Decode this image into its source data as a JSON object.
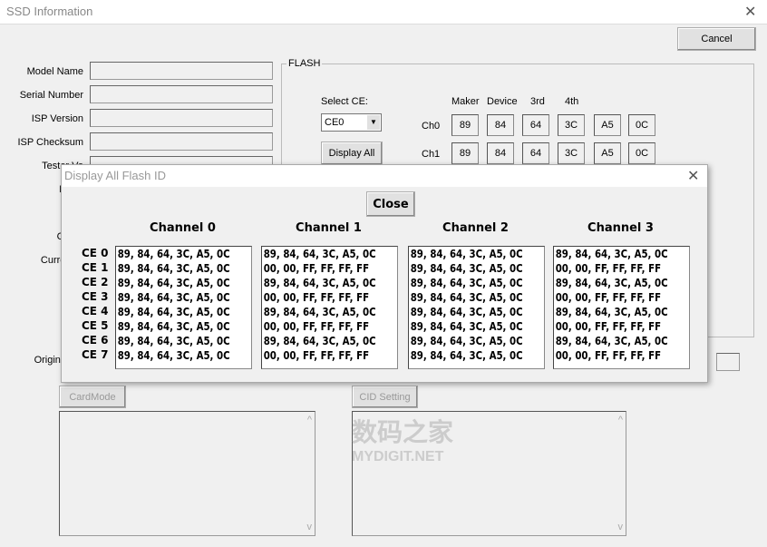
{
  "window": {
    "title": "SSD Information",
    "cancel_label": "Cancel"
  },
  "left_labels": [
    "Model Name",
    "Serial Number",
    "ISP Version",
    "ISP Checksum",
    "Tester Ve",
    "IC Ve",
    "Tota",
    "CID S",
    "Current S",
    "Original Ba"
  ],
  "flash": {
    "group_label": "FLASH",
    "select_ce_label": "Select CE:",
    "select_ce_value": "CE0",
    "display_all_label": "Display All",
    "col_headers": [
      "Maker",
      "Device",
      "3rd",
      "4th"
    ],
    "rows": [
      {
        "label": "Ch0",
        "values": [
          "89",
          "84",
          "64",
          "3C",
          "A5",
          "0C"
        ]
      },
      {
        "label": "Ch1",
        "values": [
          "89",
          "84",
          "64",
          "3C",
          "A5",
          "0C"
        ]
      }
    ]
  },
  "dialog": {
    "title": "Display All Flash ID",
    "close_label": "Close",
    "ce_labels": [
      "CE 0",
      "CE 1",
      "CE 2",
      "CE 3",
      "CE 4",
      "CE 5",
      "CE 6",
      "CE 7"
    ],
    "channels": [
      {
        "name": "Channel 0",
        "lines": [
          "89, 84, 64, 3C, A5, 0C",
          "89, 84, 64, 3C, A5, 0C",
          "89, 84, 64, 3C, A5, 0C",
          "89, 84, 64, 3C, A5, 0C",
          "89, 84, 64, 3C, A5, 0C",
          "89, 84, 64, 3C, A5, 0C",
          "89, 84, 64, 3C, A5, 0C",
          "89, 84, 64, 3C, A5, 0C"
        ]
      },
      {
        "name": "Channel 1",
        "lines": [
          "89, 84, 64, 3C, A5, 0C",
          "00, 00, FF, FF, FF, FF",
          "89, 84, 64, 3C, A5, 0C",
          "00, 00, FF, FF, FF, FF",
          "89, 84, 64, 3C, A5, 0C",
          "00, 00, FF, FF, FF, FF",
          "89, 84, 64, 3C, A5, 0C",
          "00, 00, FF, FF, FF, FF"
        ]
      },
      {
        "name": "Channel 2",
        "lines": [
          "89, 84, 64, 3C, A5, 0C",
          "89, 84, 64, 3C, A5, 0C",
          "89, 84, 64, 3C, A5, 0C",
          "89, 84, 64, 3C, A5, 0C",
          "89, 84, 64, 3C, A5, 0C",
          "89, 84, 64, 3C, A5, 0C",
          "89, 84, 64, 3C, A5, 0C",
          "89, 84, 64, 3C, A5, 0C"
        ]
      },
      {
        "name": "Channel 3",
        "lines": [
          "89, 84, 64, 3C, A5, 0C",
          "00, 00, FF, FF, FF, FF",
          "89, 84, 64, 3C, A5, 0C",
          "00, 00, FF, FF, FF, FF",
          "89, 84, 64, 3C, A5, 0C",
          "00, 00, FF, FF, FF, FF",
          "89, 84, 64, 3C, A5, 0C",
          "00, 00, FF, FF, FF, FF"
        ]
      }
    ]
  },
  "bottom": {
    "cardmode_label": "CardMode",
    "cid_setting_label": "CID Setting"
  },
  "watermark": {
    "text_cn": "数码之家",
    "text_en": "MYDIGIT.NET"
  }
}
